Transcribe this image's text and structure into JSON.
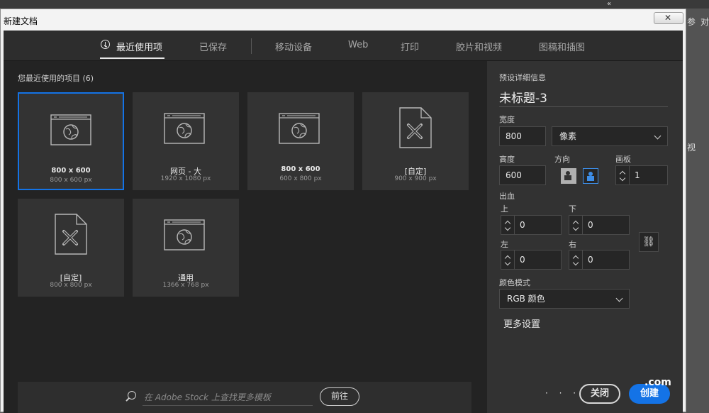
{
  "window": {
    "title": "新建文档",
    "close_label": "✕"
  },
  "background": {
    "top_arrows": "«",
    "right_text_1": "参",
    "right_text_2": "对",
    "right_text_3": "视"
  },
  "tabs": [
    {
      "label": "最近使用项",
      "active": true
    },
    {
      "label": "已保存",
      "active": false
    },
    {
      "label": "移动设备",
      "active": false
    },
    {
      "label": "Web",
      "active": false
    },
    {
      "label": "打印",
      "active": false
    },
    {
      "label": "胶片和视频",
      "active": false
    },
    {
      "label": "图稿和插图",
      "active": false
    }
  ],
  "recent": {
    "section_title": "您最近使用的项目 (6)",
    "items": [
      {
        "name": "800 x 600",
        "size": "800 x 600 px",
        "icon": "web-document-icon",
        "selected": true
      },
      {
        "name": "网页 - 大",
        "size": "1920 x 1080 px",
        "icon": "web-document-icon",
        "selected": false
      },
      {
        "name": "800 x 600",
        "size": "600 x 800 px",
        "icon": "web-document-icon",
        "selected": false
      },
      {
        "name": "[自定]",
        "size": "900 x 900 px",
        "icon": "custom-document-icon",
        "selected": false
      },
      {
        "name": "[自定]",
        "size": "800 x 800 px",
        "icon": "custom-document-icon",
        "selected": false
      },
      {
        "name": "通用",
        "size": "1366 x 768 px",
        "icon": "web-document-icon",
        "selected": false
      }
    ]
  },
  "stock": {
    "placeholder": "在 Adobe Stock 上查找更多模板",
    "go_label": "前往"
  },
  "preset": {
    "section_title": "预设详细信息",
    "doc_name": "未标题-3",
    "width_label": "宽度",
    "width_value": "800",
    "unit_value": "像素",
    "height_label": "高度",
    "height_value": "600",
    "orientation_label": "方向",
    "artboard_label": "画板",
    "artboard_value": "1",
    "bleed_label": "出血",
    "bleed_top_label": "上",
    "bleed_top_value": "0",
    "bleed_bottom_label": "下",
    "bleed_bottom_value": "0",
    "bleed_left_label": "左",
    "bleed_left_value": "0",
    "bleed_right_label": "右",
    "bleed_right_value": "0",
    "color_mode_label": "颜色模式",
    "color_mode_value": "RGB 颜色",
    "more_settings": "更多设置"
  },
  "actions": {
    "close_label": "关闭",
    "create_label": "创建",
    "watermark": ".com",
    "dots": "· · ·"
  },
  "colors": {
    "accent": "#1473e6",
    "panel": "#323232",
    "dialog": "#232323"
  }
}
